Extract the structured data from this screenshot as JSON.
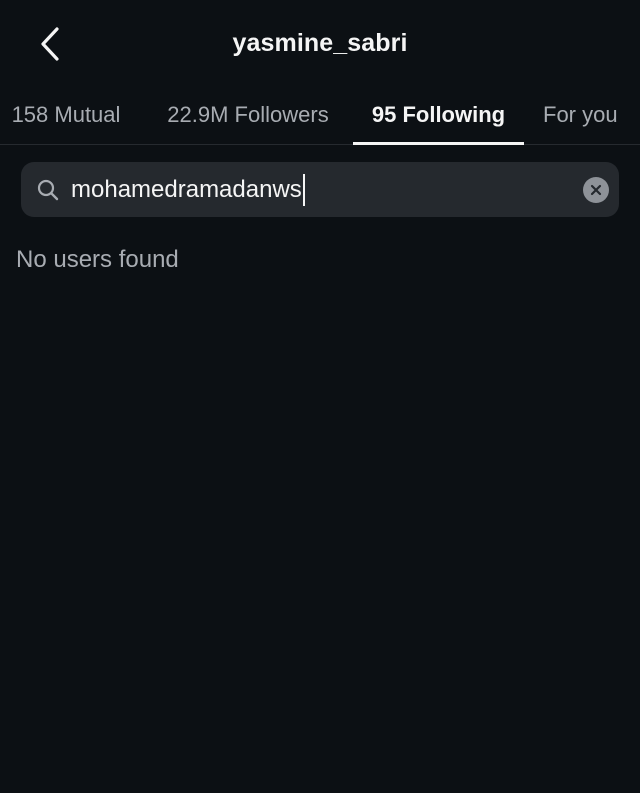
{
  "header": {
    "title": "yasmine_sabri",
    "back_icon": "chevron-left-icon"
  },
  "tabs": [
    {
      "label": "158 Mutual",
      "active": false
    },
    {
      "label": "22.9M Followers",
      "active": false
    },
    {
      "label": "95 Following",
      "active": true
    },
    {
      "label": "For you",
      "active": false
    }
  ],
  "search": {
    "value": "mohamedramadanws",
    "icon": "search-icon",
    "clear_icon": "clear-icon"
  },
  "results": {
    "empty_message": "No users found"
  },
  "colors": {
    "background": "#0c1014",
    "search_field": "#25292e",
    "primary_text": "#f5f5f5",
    "secondary_text": "#a8acb2",
    "divider": "#262a2f"
  }
}
